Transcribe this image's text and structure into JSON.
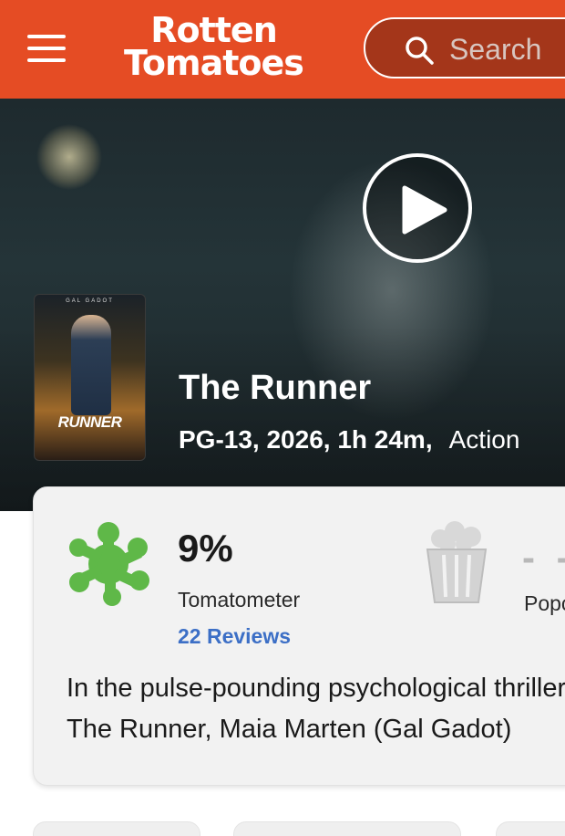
{
  "header": {
    "logo_line1": "Rotten",
    "logo_line2": "Tomatoes",
    "search_placeholder": "Search",
    "brand_color": "#e54c24",
    "icons": [
      "hamburger-menu-icon",
      "search-icon"
    ]
  },
  "movie": {
    "title": "The Runner",
    "meta": "PG-13, 2026, 1h 24m,",
    "genre": "Action",
    "poster_title": "RUNNER",
    "poster_actor": "GAL GADOT"
  },
  "scores": {
    "tomatometer_value": "9%",
    "tomatometer_label": "Tomatometer",
    "reviews_link": "22 Reviews",
    "popcornmeter_value": "- -",
    "popcornmeter_label": "Popcornmeter",
    "tomatometer_icon": "rotten-splat-icon",
    "popcornmeter_icon": "empty-popcorn-icon",
    "splat_color": "#5fb848",
    "link_color": "#3c6fc6"
  },
  "synopsis": {
    "line1": "In the pulse-pounding psychological thriller",
    "line2": "The Runner, Maia Marten (Gal Gadot)"
  }
}
